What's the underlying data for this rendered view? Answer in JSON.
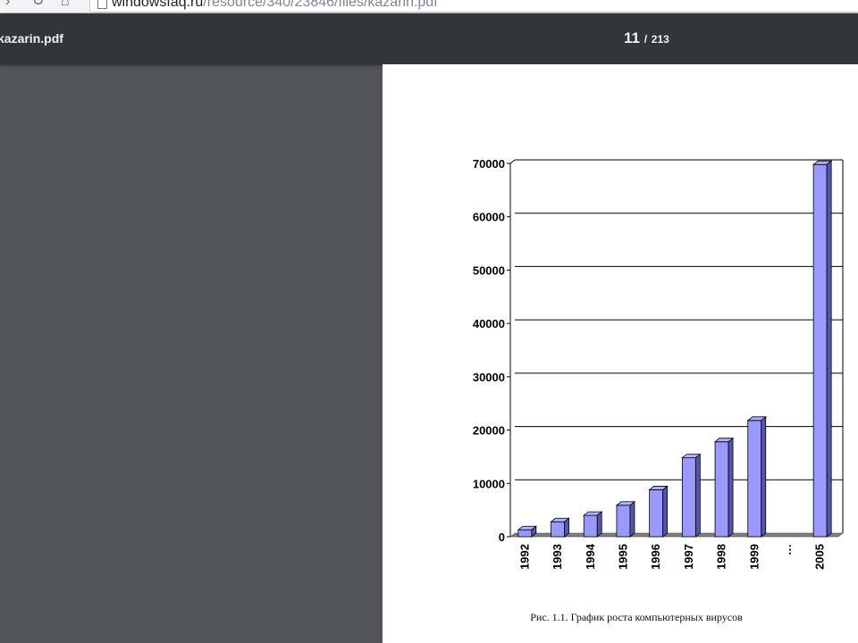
{
  "browser": {
    "url_host": "windowsfaq.ru",
    "url_path": "/resource/340/23846/files/kazarin.pdf"
  },
  "viewer": {
    "filename": "kazarin.pdf",
    "current_page": "11",
    "separator": "/",
    "total_pages": "213"
  },
  "chart_data": {
    "type": "bar",
    "categories": [
      "1992",
      "1993",
      "1994",
      "1995",
      "1996",
      "1997",
      "1998",
      "1999",
      "…",
      "2005"
    ],
    "values": [
      1300,
      2800,
      4000,
      5900,
      8800,
      14800,
      17800,
      21800,
      null,
      69800
    ],
    "ylim": [
      0,
      70000
    ],
    "yticks": [
      0,
      10000,
      20000,
      30000,
      40000,
      50000,
      60000,
      70000
    ],
    "grid": true,
    "bar_color": "#9999ff",
    "caption": "Рис. 1.1. График роста компьютерных вирусов"
  }
}
